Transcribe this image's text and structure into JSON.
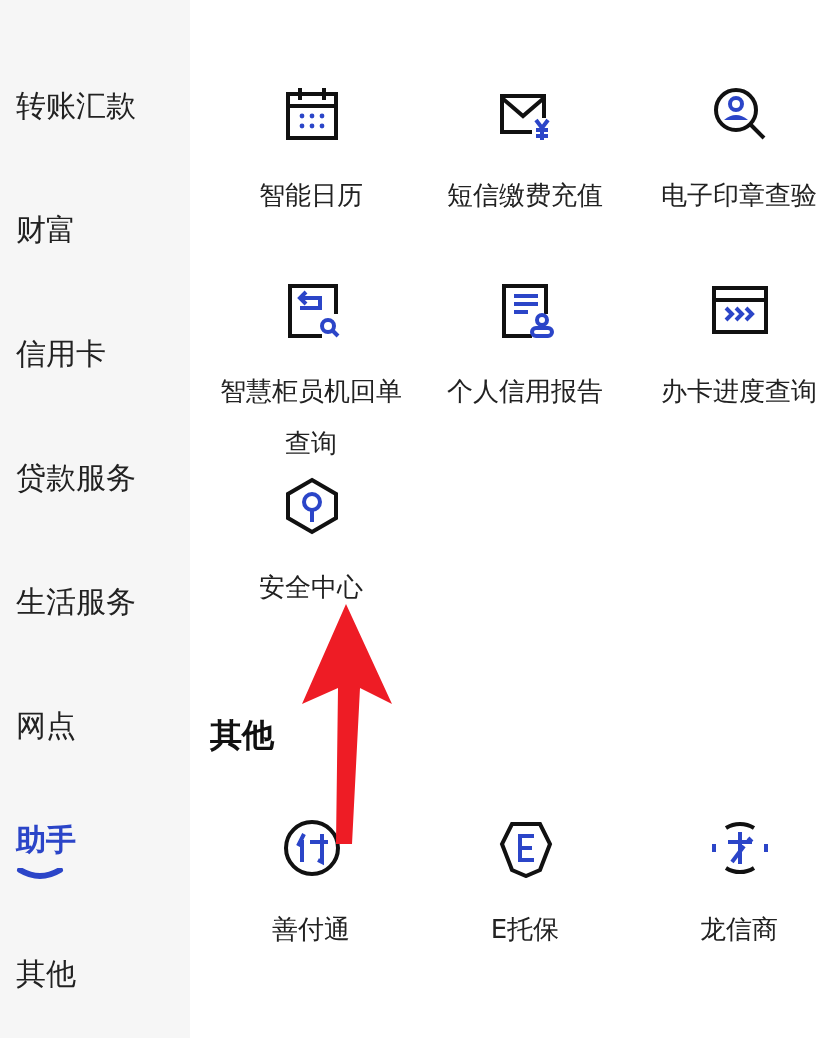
{
  "sidebar": {
    "items": [
      {
        "label": "转账汇款",
        "selected": false
      },
      {
        "label": "财富",
        "selected": false
      },
      {
        "label": "信用卡",
        "selected": false
      },
      {
        "label": "贷款服务",
        "selected": false
      },
      {
        "label": "生活服务",
        "selected": false
      },
      {
        "label": "网点",
        "selected": false
      },
      {
        "label": "助手",
        "selected": true
      },
      {
        "label": "其他",
        "selected": false
      }
    ]
  },
  "sections": [
    {
      "items": [
        {
          "label": "智能日历"
        },
        {
          "label": "短信缴费充值"
        },
        {
          "label": "电子印章查验"
        },
        {
          "label": "智慧柜员机回单查询"
        },
        {
          "label": "个人信用报告"
        },
        {
          "label": "办卡进度查询"
        },
        {
          "label": "安全中心"
        }
      ]
    },
    {
      "title": "其他",
      "items": [
        {
          "label": "善付通"
        },
        {
          "label": "E托保"
        },
        {
          "label": "龙信商"
        }
      ]
    }
  ]
}
